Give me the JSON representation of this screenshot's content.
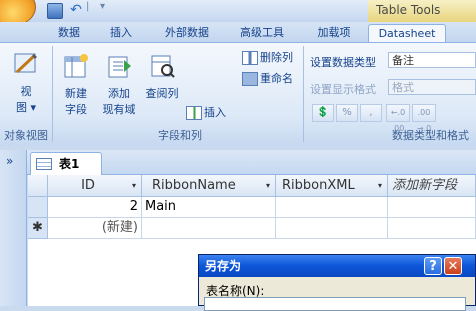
{
  "title_bar": {
    "contextual_title": "Table Tools",
    "quick_access": {
      "save_icon": "save-icon",
      "undo_icon": "undo-icon",
      "undo_glyph": "↶",
      "customize_glyph": "▾",
      "separator_glyph": "|"
    }
  },
  "tabs": [
    {
      "label": "数据"
    },
    {
      "label": "插入"
    },
    {
      "label": "外部数据"
    },
    {
      "label": "高级工具"
    },
    {
      "label": "加载项"
    },
    {
      "label": "Datasheet"
    }
  ],
  "ribbon": {
    "views": {
      "button_label_1": "视",
      "button_label_2": "图",
      "dropdown_glyph": "▾",
      "group_label": "对象视图"
    },
    "fields": {
      "new_field_1": "新建",
      "new_field_2": "字段",
      "add_existing_1": "添加",
      "add_existing_2": "现有域",
      "lookup_column": "查阅列",
      "delete_column": "删除列",
      "rename": "重命名",
      "insert": "插入",
      "group_label": "字段和列"
    },
    "datatype": {
      "data_type_label": "设置数据类型",
      "data_type_value": "备注",
      "format_label": "设置显示格式",
      "format_placeholder": "格式",
      "currency_glyph": "💲",
      "percent_glyph": "%",
      "comma_glyph": ",",
      "inc_decimals": "←.0 .00",
      "dec_decimals": ".00 →.0",
      "group_label": "数据类型和格式"
    }
  },
  "document": {
    "nav_chevron": "»",
    "tab_label": "表1",
    "columns": [
      {
        "label": "ID",
        "dropdown": "▾"
      },
      {
        "label": "RibbonName",
        "dropdown": "▾"
      },
      {
        "label": "RibbonXML",
        "dropdown": "▾"
      },
      {
        "label": "添加新字段",
        "dropdown": ""
      }
    ],
    "rows": [
      {
        "selector": "",
        "id": "2",
        "ribbon_name": "Main",
        "ribbon_xml": ""
      },
      {
        "selector": "✱",
        "id": "(新建)",
        "ribbon_name": "",
        "ribbon_xml": ""
      }
    ]
  },
  "dialog": {
    "title": "另存为",
    "help_glyph": "?",
    "close_glyph": "✕",
    "name_label": "表名称(N):"
  }
}
